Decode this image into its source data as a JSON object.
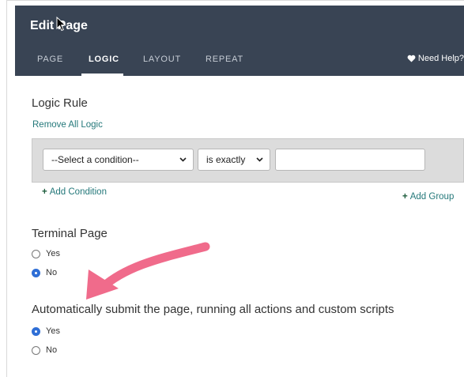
{
  "header": {
    "title": "Edit Page",
    "tabs": [
      {
        "label": "PAGE"
      },
      {
        "label": "LOGIC"
      },
      {
        "label": "LAYOUT"
      },
      {
        "label": "REPEAT"
      }
    ],
    "active_tab": "LOGIC",
    "help_label": "Need Help?"
  },
  "logic": {
    "title": "Logic Rule",
    "remove_all": "Remove All Logic",
    "condition_select": "--Select a condition--",
    "operator_select": "is exactly",
    "value_input": "",
    "add_condition": "Add Condition",
    "add_group": "Add Group",
    "plus": "+"
  },
  "terminal": {
    "title": "Terminal Page",
    "options": [
      {
        "label": "Yes",
        "checked": false
      },
      {
        "label": "No",
        "checked": true
      }
    ]
  },
  "autosubmit": {
    "title": "Automatically submit the page, running all actions and custom scripts",
    "options": [
      {
        "label": "Yes",
        "checked": true
      },
      {
        "label": "No",
        "checked": false
      }
    ]
  },
  "colors": {
    "header_bg": "#394454",
    "link": "#24787a",
    "arrow": "#f06b8b",
    "radio_checked": "#2f6fd6"
  }
}
